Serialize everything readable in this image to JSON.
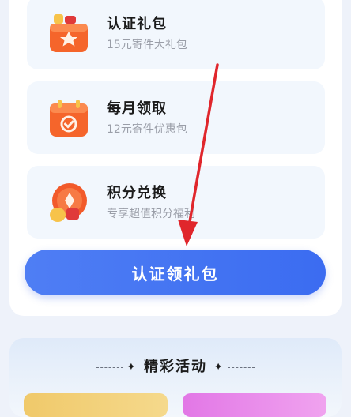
{
  "benefits": [
    {
      "title": "认证礼包",
      "subtitle": "15元寄件大礼包",
      "icon": "gift-box-icon"
    },
    {
      "title": "每月领取",
      "subtitle": "12元寄件优惠包",
      "icon": "calendar-check-icon"
    },
    {
      "title": "积分兑换",
      "subtitle": "专享超值积分福利",
      "icon": "coin-points-icon"
    }
  ],
  "main_button": {
    "label": "认证领礼包"
  },
  "activity": {
    "heading": "精彩活动"
  },
  "colors": {
    "accent": "#3b6cf1",
    "arrow": "#e0262c",
    "icon_orange": "#f5652b"
  }
}
